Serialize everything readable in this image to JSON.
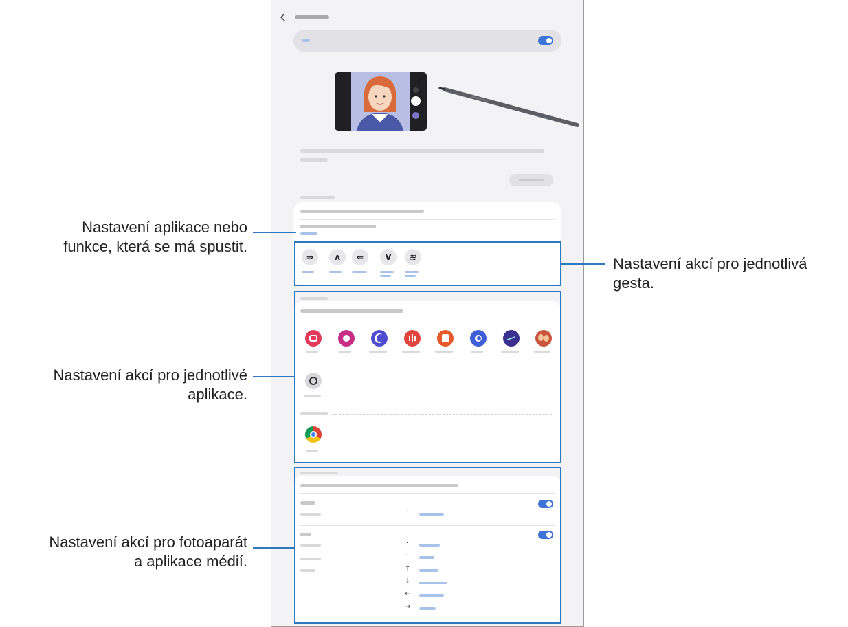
{
  "callouts": {
    "app_launch": [
      "Nastavení aplikace nebo",
      "funkce, která se má spustit."
    ],
    "gesture_actions": [
      "Nastavení akcí pro jednotlivá",
      "gesta."
    ],
    "app_actions": [
      "Nastavení akcí pro jednotlivé",
      "aplikace."
    ],
    "media_actions": [
      "Nastavení akcí pro fotoaparát",
      "a aplikace médií."
    ]
  },
  "icons": {
    "back": "chevron-left-icon",
    "apps": [
      "camera-icon",
      "gallery-icon",
      "internet-icon",
      "voice-recorder-icon",
      "notes-icon",
      "penup-icon",
      "live-drawing-icon",
      "ar-emoji-icon",
      "pen-app-icon",
      "chrome-icon"
    ]
  },
  "gesture_symbols": [
    "⇒",
    "ʌ",
    "⇐",
    "V",
    "≋"
  ],
  "media_symbols": [
    "·",
    "··",
    "↑",
    "↓",
    "←",
    "→"
  ],
  "colors": {
    "accent": "#3e74d9",
    "highlight": "#2d79c0",
    "card_bg": "#ffffff",
    "screen_bg": "#f3f3f5"
  }
}
